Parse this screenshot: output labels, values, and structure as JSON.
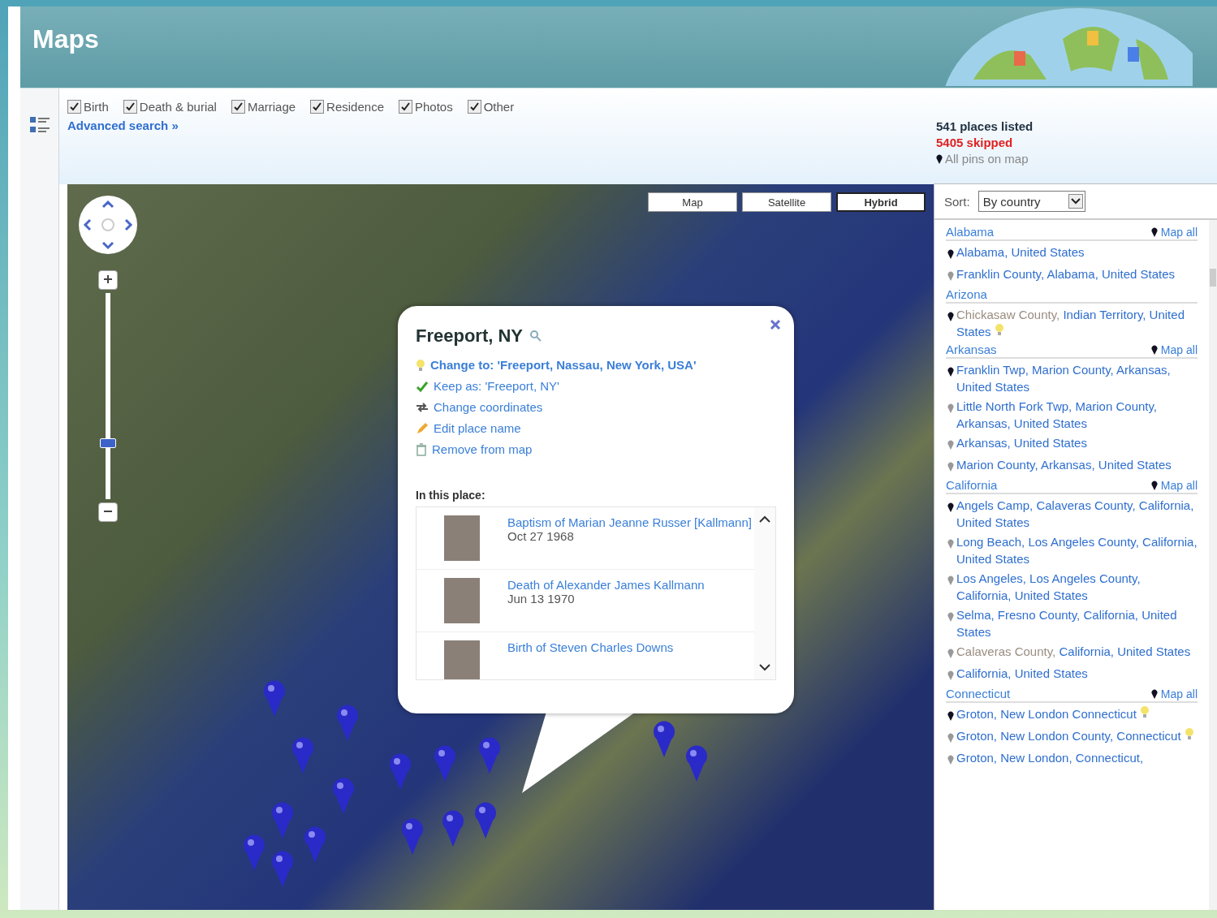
{
  "header": {
    "title": "Maps"
  },
  "filters": [
    {
      "label": "Birth",
      "checked": true
    },
    {
      "label": "Death & burial",
      "checked": true
    },
    {
      "label": "Marriage",
      "checked": true
    },
    {
      "label": "Residence",
      "checked": true
    },
    {
      "label": "Photos",
      "checked": true
    },
    {
      "label": "Other",
      "checked": true
    }
  ],
  "advanced_search": "Advanced search »",
  "stats": {
    "listed": "541 places listed",
    "skipped": "5405 skipped",
    "all_pins": "All pins on map"
  },
  "map": {
    "zoom": {
      "level": 0.26
    },
    "map_types": [
      {
        "label": "Map",
        "selected": false
      },
      {
        "label": "Satellite",
        "selected": false
      },
      {
        "label": "Hybrid",
        "selected": true
      }
    ],
    "popup": {
      "title": "Freeport, NY",
      "actions": [
        {
          "kind": "suggest",
          "label": "Change to: 'Freeport, Nassau, New York, USA'"
        },
        {
          "kind": "keep",
          "label": "Keep as: 'Freeport, NY'"
        },
        {
          "kind": "coords",
          "label": "Change coordinates"
        },
        {
          "kind": "edit",
          "label": "Edit place name"
        },
        {
          "kind": "remove",
          "label": "Remove from map"
        }
      ],
      "section_label": "In this place:",
      "events": [
        {
          "title": "Baptism of Marian Jeanne Russer [Kallmann]",
          "date": "Oct 27 1968"
        },
        {
          "title": "Death of Alexander James Kallmann",
          "date": "Jun 13 1970"
        },
        {
          "title": "Birth of Steven Charles Downs"
        }
      ]
    }
  },
  "sort": {
    "label": "Sort:",
    "value": "By country"
  },
  "groups": [
    {
      "name": "Alabama",
      "map_all": "Map all",
      "places": [
        {
          "text": "Alabama, United States",
          "highlighted": true
        },
        {
          "text": "Franklin County, Alabama, United States",
          "highlighted": false
        }
      ]
    },
    {
      "name": "Arizona",
      "places": [
        {
          "muted": "Chickasaw County, ",
          "text": "Indian Territory, United States",
          "highlighted": true,
          "suggestion": true
        }
      ]
    },
    {
      "name": "Arkansas",
      "map_all": "Map all",
      "places": [
        {
          "text": "Franklin Twp, Marion County, Arkansas, United States",
          "highlighted": true
        },
        {
          "text": "Little North Fork Twp, Marion County, Arkansas, United States",
          "highlighted": false
        },
        {
          "text": "Arkansas, United States",
          "highlighted": false
        },
        {
          "text": "Marion County, Arkansas, United States",
          "highlighted": false
        }
      ]
    },
    {
      "name": "California",
      "map_all": "Map all",
      "places": [
        {
          "text": "Angels Camp, Calaveras County, California, United States",
          "highlighted": true
        },
        {
          "text": "Long Beach, Los Angeles County, California, United States",
          "highlighted": false
        },
        {
          "text": "Los Angeles, Los Angeles County, California, United States",
          "highlighted": false
        },
        {
          "text": "Selma, Fresno County, California, United States",
          "highlighted": false
        },
        {
          "muted": "Calaveras County, ",
          "text": "California, United States",
          "highlighted": false
        },
        {
          "text": "California, United States",
          "highlighted": false
        }
      ]
    },
    {
      "name": "Connecticut",
      "map_all": "Map all",
      "places": [
        {
          "text": "Groton, New London Connecticut",
          "highlighted": true,
          "suggestion": true
        },
        {
          "text": "Groton, New London County, Connecticut",
          "highlighted": false,
          "suggestion": true
        },
        {
          "text": "Groton, New London, Connecticut,",
          "highlighted": false
        }
      ]
    }
  ]
}
